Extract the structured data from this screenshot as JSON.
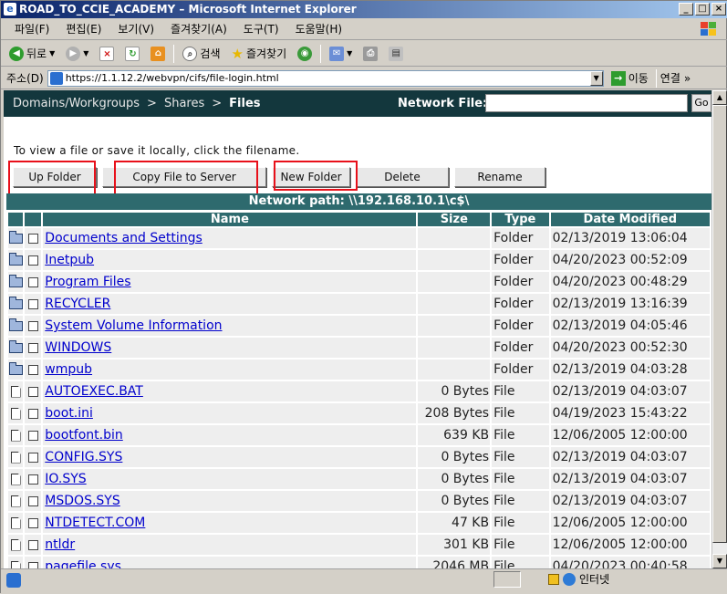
{
  "window": {
    "title": "ROAD_TO_CCIE_ACADEMY – Microsoft Internet Explorer",
    "controls": [
      "_",
      "□",
      "×"
    ]
  },
  "menu": [
    "파일(F)",
    "편집(E)",
    "보기(V)",
    "즐겨찾기(A)",
    "도구(T)",
    "도움말(H)"
  ],
  "toolbar": {
    "back": "뒤로",
    "search": "검색",
    "favorites": "즐겨찾기"
  },
  "address": {
    "label": "주소(D)",
    "url": "https://1.1.12.2/webvpn/cifs/file-login.html",
    "go": "이동",
    "links": "연결"
  },
  "nav": {
    "crumbs": [
      "Domains/Workgroups",
      "Shares",
      "Files"
    ],
    "network_file_label": "Network File:",
    "go_label": "Go"
  },
  "instructions": "To view a file or save it locally, click the filename.",
  "buttons": {
    "up_folder": "Up Folder",
    "copy_file": "Copy File to Server",
    "new_folder": "New Folder",
    "delete": "Delete",
    "rename": "Rename"
  },
  "network_path": "Network path: \\\\192.168.10.1\\c$\\",
  "columns": [
    "Name",
    "Size",
    "Type",
    "Date Modified"
  ],
  "rows": [
    {
      "icon": "folder",
      "name": "Documents and Settings",
      "size": "",
      "type": "Folder",
      "date": "02/13/2019 13:06:04"
    },
    {
      "icon": "folder",
      "name": "Inetpub",
      "size": "",
      "type": "Folder",
      "date": "04/20/2023 00:52:09"
    },
    {
      "icon": "folder",
      "name": "Program Files",
      "size": "",
      "type": "Folder",
      "date": "04/20/2023 00:48:29"
    },
    {
      "icon": "folder",
      "name": "RECYCLER",
      "size": "",
      "type": "Folder",
      "date": "02/13/2019 13:16:39"
    },
    {
      "icon": "folder",
      "name": "System Volume Information",
      "size": "",
      "type": "Folder",
      "date": "02/13/2019 04:05:46"
    },
    {
      "icon": "folder",
      "name": "WINDOWS",
      "size": "",
      "type": "Folder",
      "date": "04/20/2023 00:52:30"
    },
    {
      "icon": "folder",
      "name": "wmpub",
      "size": "",
      "type": "Folder",
      "date": "02/13/2019 04:03:28"
    },
    {
      "icon": "file",
      "name": "AUTOEXEC.BAT",
      "size": "0 Bytes",
      "type": "File",
      "date": "02/13/2019 04:03:07"
    },
    {
      "icon": "file",
      "name": "boot.ini",
      "size": "208 Bytes",
      "type": "File",
      "date": "04/19/2023 15:43:22"
    },
    {
      "icon": "file",
      "name": "bootfont.bin",
      "size": "639 KB",
      "type": "File",
      "date": "12/06/2005 12:00:00"
    },
    {
      "icon": "file",
      "name": "CONFIG.SYS",
      "size": "0 Bytes",
      "type": "File",
      "date": "02/13/2019 04:03:07"
    },
    {
      "icon": "file",
      "name": "IO.SYS",
      "size": "0 Bytes",
      "type": "File",
      "date": "02/13/2019 04:03:07"
    },
    {
      "icon": "file",
      "name": "MSDOS.SYS",
      "size": "0 Bytes",
      "type": "File",
      "date": "02/13/2019 04:03:07"
    },
    {
      "icon": "file",
      "name": "NTDETECT.COM",
      "size": "47 KB",
      "type": "File",
      "date": "12/06/2005 12:00:00"
    },
    {
      "icon": "file",
      "name": "ntldr",
      "size": "301 KB",
      "type": "File",
      "date": "12/06/2005 12:00:00"
    },
    {
      "icon": "file",
      "name": "pagefile.sys",
      "size": "2046 MB",
      "type": "File",
      "date": "04/20/2023 00:40:58"
    }
  ],
  "status": {
    "zone": "인터넷"
  },
  "colors": {
    "nav_bg": "#13373d",
    "header_bg": "#2e6a6e",
    "highlight": "#e8101a",
    "link": "#0000cc"
  }
}
